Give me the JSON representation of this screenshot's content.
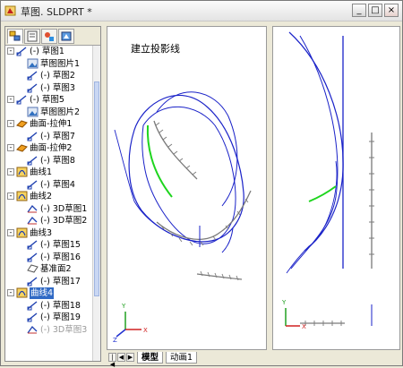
{
  "window": {
    "title": "草图. SLDPRT *",
    "min_label": "_",
    "max_label": "□",
    "close_label": "×"
  },
  "tabs": [
    {
      "name": "feature-manager-tab"
    },
    {
      "name": "property-manager-tab"
    },
    {
      "name": "configuration-manager-tab"
    },
    {
      "name": "dim-xpert-tab"
    }
  ],
  "tree": [
    {
      "label": "(-) 草图1",
      "icon": "sketch-icon",
      "expand": "-"
    },
    {
      "label": "草图图片1",
      "icon": "sketch-picture-icon",
      "expand": ""
    },
    {
      "label": "(-) 草图2",
      "icon": "sketch-icon",
      "expand": ""
    },
    {
      "label": "(-) 草图3",
      "icon": "sketch-icon",
      "expand": ""
    },
    {
      "label": "(-) 草图5",
      "icon": "sketch-icon",
      "expand": "-"
    },
    {
      "label": "草图图片2",
      "icon": "sketch-picture-icon",
      "expand": ""
    },
    {
      "label": "曲面-拉伸1",
      "icon": "surface-extrude-icon",
      "expand": "-"
    },
    {
      "label": "(-) 草图7",
      "icon": "sketch-icon",
      "expand": ""
    },
    {
      "label": "曲面-拉伸2",
      "icon": "surface-extrude-icon",
      "expand": "-"
    },
    {
      "label": "(-) 草图8",
      "icon": "sketch-icon",
      "expand": ""
    },
    {
      "label": "曲线1",
      "icon": "curve-icon",
      "expand": "-"
    },
    {
      "label": "(-) 草图4",
      "icon": "sketch-icon",
      "expand": ""
    },
    {
      "label": "曲线2",
      "icon": "curve-icon",
      "expand": "-"
    },
    {
      "label": "(-) 3D草图1",
      "icon": "3d-sketch-icon",
      "expand": ""
    },
    {
      "label": "(-) 3D草图2",
      "icon": "3d-sketch-icon",
      "expand": ""
    },
    {
      "label": "曲线3",
      "icon": "curve-icon",
      "expand": "-"
    },
    {
      "label": "(-) 草图15",
      "icon": "sketch-icon",
      "expand": ""
    },
    {
      "label": "(-) 草图16",
      "icon": "sketch-icon",
      "expand": ""
    },
    {
      "label": "基准面2",
      "icon": "plane-icon",
      "expand": ""
    },
    {
      "label": "(-) 草图17",
      "icon": "sketch-icon",
      "expand": ""
    },
    {
      "label": "曲线4",
      "icon": "curve-icon",
      "expand": "-",
      "selected": true
    },
    {
      "label": "(-) 草图18",
      "icon": "sketch-icon",
      "expand": ""
    },
    {
      "label": "(-) 草图19",
      "icon": "sketch-icon",
      "expand": ""
    },
    {
      "label": "(-) 3D草图3",
      "icon": "3d-sketch-icon",
      "expand": "",
      "faded": true
    }
  ],
  "viewport": {
    "note": "建立投影线"
  },
  "bottom_tabs": [
    {
      "label": "模型",
      "active": true
    },
    {
      "label": "动画1",
      "active": false
    }
  ],
  "colors": {
    "curve_blue": "#1a22c8",
    "curve_green": "#1ed51e",
    "curve_gray": "#7a7a7a",
    "selection_highlight": "#316ac5"
  }
}
